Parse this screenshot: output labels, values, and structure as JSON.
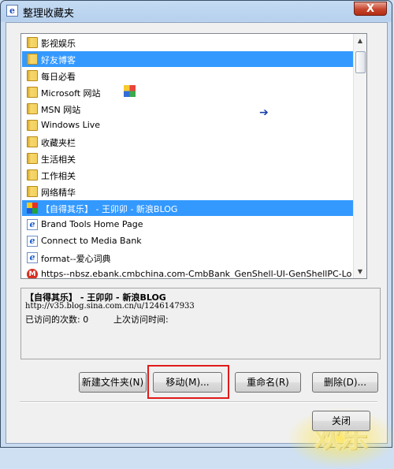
{
  "window": {
    "title": "整理收藏夹",
    "close_label": "X"
  },
  "list": {
    "items": [
      {
        "label": "影视娱乐",
        "icon": "folder-icon",
        "selected": false
      },
      {
        "label": "好友博客",
        "icon": "folder-icon",
        "selected": true
      },
      {
        "label": "每日必看",
        "icon": "folder-icon",
        "selected": false
      },
      {
        "label": "Microsoft 网站",
        "icon": "folder-icon",
        "selected": false
      },
      {
        "label": "MSN 网站",
        "icon": "folder-icon",
        "selected": false
      },
      {
        "label": "Windows Live",
        "icon": "folder-icon",
        "selected": false
      },
      {
        "label": "收藏夹栏",
        "icon": "folder-icon",
        "selected": false
      },
      {
        "label": "生活相关",
        "icon": "folder-icon",
        "selected": false
      },
      {
        "label": "工作相关",
        "icon": "folder-icon",
        "selected": false
      },
      {
        "label": "网络精华",
        "icon": "folder-icon",
        "selected": false
      },
      {
        "label": "【自得其乐】 - 王卯卯 - 新浪BLOG",
        "icon": "sina-icon",
        "selected": true
      },
      {
        "label": "Brand Tools Home Page",
        "icon": "ie-page-icon",
        "selected": false
      },
      {
        "label": "Connect to Media Bank",
        "icon": "ie-page-icon",
        "selected": false
      },
      {
        "label": "format--爱心词典",
        "icon": "ie-page-icon",
        "selected": false
      },
      {
        "label": "https--nbsz.ebank.cmbchina.com-CmbBank_GenShell-UI-GenShellPC-Lo",
        "icon": "mbank-icon",
        "selected": false
      }
    ],
    "drag_ghost_label": "【自得其乐】 - 王卯卯 - 新浪BLOG"
  },
  "info": {
    "title": "【自得其乐】 - 王卯卯 - 新浪BLOG",
    "url": "http://v35.blog.sina.com.cn/u/1246147933",
    "visits": "已访问的次数: 0",
    "last_visit": "上次访问时间:"
  },
  "buttons": {
    "new_folder": "新建文件夹(N)",
    "move": "移动(M)...",
    "rename": "重命名(R)",
    "delete": "删除(D)...",
    "close": "关闭"
  },
  "colors": {
    "selection": "#3399ff",
    "highlight_box": "#e11a1a"
  }
}
